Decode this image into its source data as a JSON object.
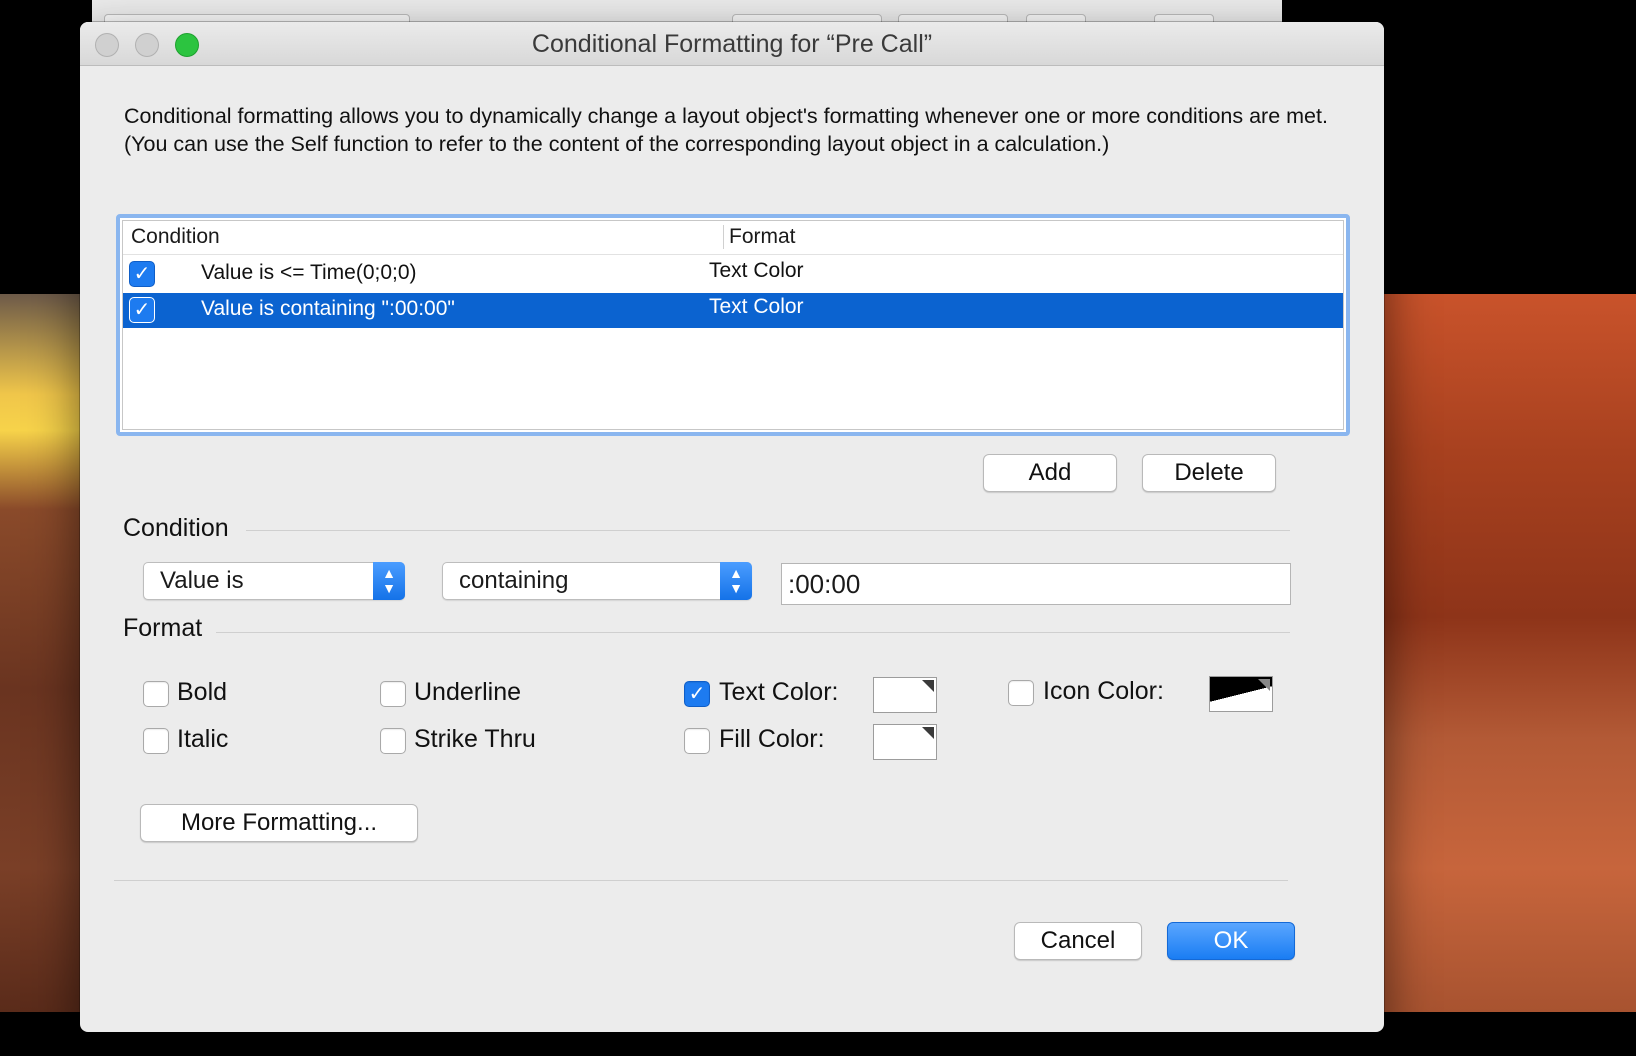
{
  "dialog": {
    "title": "Conditional Formatting for “Pre Call”",
    "description": "Conditional formatting allows you to dynamically change a layout object's formatting whenever one or more conditions are met.  (You can use the Self function to refer to the content of the corresponding layout object in a calculation.)"
  },
  "table": {
    "headers": {
      "condition": "Condition",
      "format": "Format"
    },
    "rows": [
      {
        "checked": true,
        "condition": "Value is <= Time(0;0;0)",
        "format": "Text Color",
        "selected": false
      },
      {
        "checked": true,
        "condition": "Value is containing \":00:00\"",
        "format": "Text Color",
        "selected": true
      }
    ]
  },
  "buttons": {
    "add": "Add",
    "delete": "Delete",
    "more_formatting": "More Formatting...",
    "cancel": "Cancel",
    "ok": "OK"
  },
  "condition": {
    "section_label": "Condition",
    "operand": "Value is",
    "operator": "containing",
    "value": ":00:00"
  },
  "format": {
    "section_label": "Format",
    "bold": {
      "label": "Bold",
      "checked": false
    },
    "italic": {
      "label": "Italic",
      "checked": false
    },
    "underline": {
      "label": "Underline",
      "checked": false
    },
    "strike_thru": {
      "label": "Strike Thru",
      "checked": false
    },
    "text_color": {
      "label": "Text Color:",
      "checked": true,
      "swatch": "#ffffff"
    },
    "fill_color": {
      "label": "Fill Color:",
      "checked": false,
      "swatch": "#ffffff"
    },
    "icon_color": {
      "label": "Icon Color:",
      "checked": false,
      "swatch": "#000000"
    }
  },
  "colors": {
    "accent": "#1d7bf0",
    "selection": "#0b63d0",
    "focus_ring": "#8ab6ef"
  }
}
